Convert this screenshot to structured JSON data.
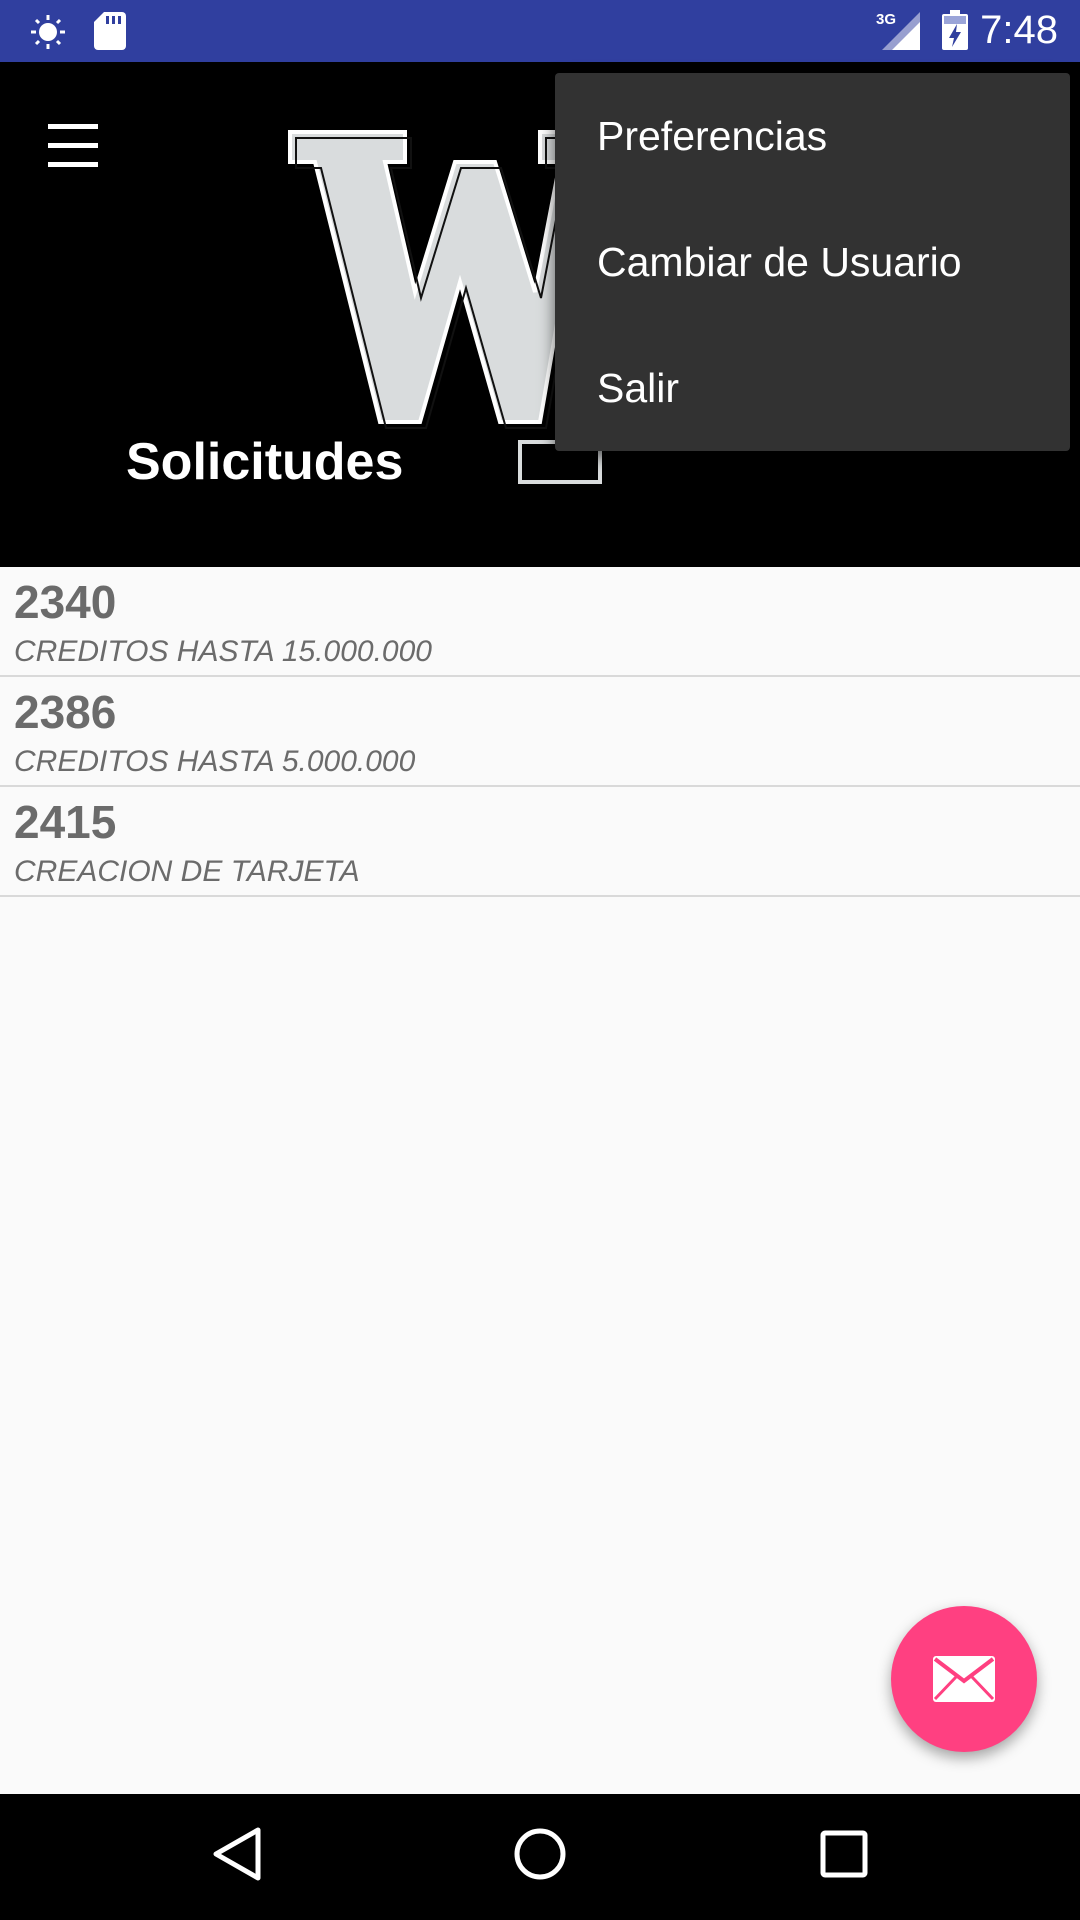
{
  "status_bar": {
    "time": "7:48",
    "network_label": "3G",
    "icons": [
      "brightness-icon",
      "sd-card-icon",
      "signal-icon",
      "battery-icon"
    ]
  },
  "header": {
    "title": "Solicitudes",
    "logo_icon": "logo-w-icon",
    "menu_icon": "hamburger-menu-icon",
    "background": "#000000"
  },
  "overflow_menu": {
    "items": [
      {
        "label": "Preferencias"
      },
      {
        "label": "Cambiar de Usuario"
      },
      {
        "label": "Salir"
      }
    ]
  },
  "requests": [
    {
      "id": "2340",
      "description": "CREDITOS HASTA 15.000.000"
    },
    {
      "id": "2386",
      "description": "CREDITOS HASTA 5.000.000"
    },
    {
      "id": "2415",
      "description": "CREACION DE TARJETA"
    }
  ],
  "fab": {
    "icon": "mail-icon",
    "color": "#ff4081"
  },
  "nav_bar": {
    "icons": [
      "back-icon",
      "home-icon",
      "recents-icon"
    ]
  },
  "colors": {
    "status_bar": "#303f9f",
    "menu_bg": "#323232",
    "list_text": "#6b6b6b"
  }
}
